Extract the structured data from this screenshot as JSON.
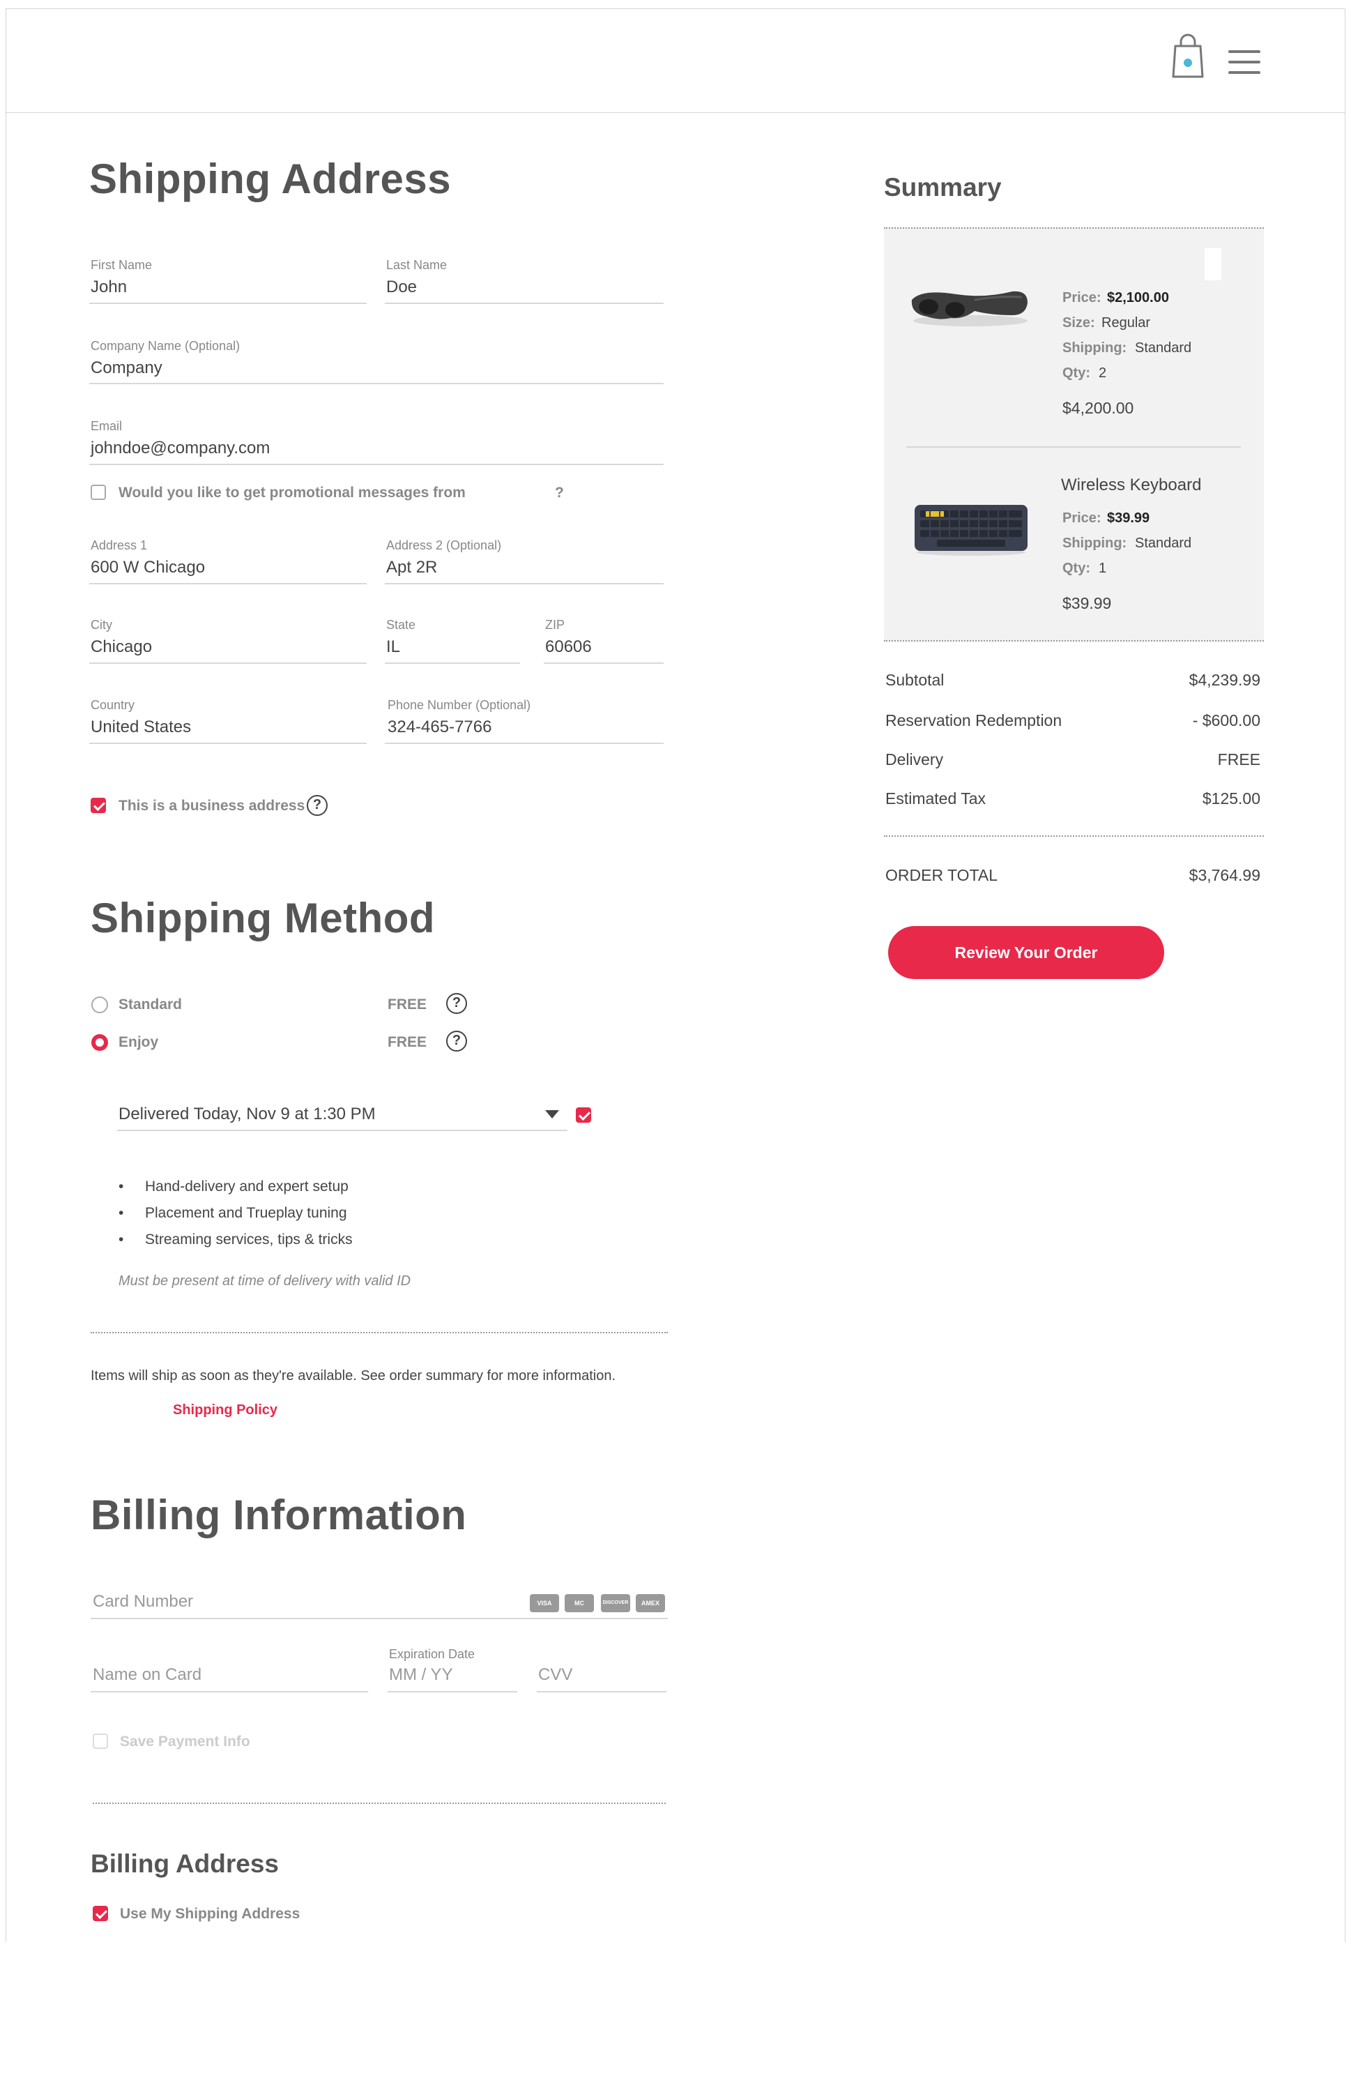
{
  "header": {
    "bag_icon": "shopping-bag-icon",
    "menu_icon": "hamburger-menu-icon"
  },
  "shipping_address": {
    "title": "Shipping Address",
    "first_name": {
      "label": "First Name",
      "value": "John"
    },
    "last_name": {
      "label": "Last Name",
      "value": "Doe"
    },
    "company": {
      "label": "Company Name (Optional)",
      "value": "Company"
    },
    "email": {
      "label": "Email",
      "value": "johndoe@company.com"
    },
    "promo_label": "Would you like to get promotional messages from",
    "promo_suffix": "?",
    "address1": {
      "label": "Address 1",
      "value": "600 W Chicago"
    },
    "address2": {
      "label": "Address 2 (Optional)",
      "value": "Apt 2R"
    },
    "city": {
      "label": "City",
      "value": "Chicago"
    },
    "state": {
      "label": "State",
      "value": "IL"
    },
    "zip": {
      "label": "ZIP",
      "value": "60606"
    },
    "country": {
      "label": "Country",
      "value": "United States"
    },
    "phone": {
      "label": "Phone Number (Optional)",
      "value": "324-465-7766"
    },
    "business_label": "This is a business address"
  },
  "shipping_method": {
    "title": "Shipping Method",
    "options": [
      {
        "label": "Standard",
        "price": "FREE",
        "selected": false
      },
      {
        "label": "Enjoy",
        "price": "FREE",
        "selected": true
      }
    ],
    "delivery_time": "Delivered Today, Nov 9 at 1:30 PM",
    "bullets": [
      "Hand-delivery and expert setup",
      "Placement and Trueplay tuning",
      "Streaming services, tips & tricks"
    ],
    "note": "Must be present at time of delivery with valid ID",
    "ship_info": "Items will ship as soon as they're available. See order summary for more information.",
    "policy_link": "Shipping Policy"
  },
  "billing": {
    "title": "Billing Information",
    "card_number_placeholder": "Card Number",
    "card_logos": [
      "VISA",
      "MC",
      "DISCOVER",
      "AMEX"
    ],
    "name_placeholder": "Name on Card",
    "expiration_label": "Expiration Date",
    "expiration_placeholder": "MM / YY",
    "cvv_placeholder": "CVV",
    "save_label": "Save Payment Info",
    "address_title": "Billing Address",
    "use_shipping_label": "Use My Shipping Address"
  },
  "summary": {
    "title": "Summary",
    "items": [
      {
        "name": "",
        "price_label": "Price:",
        "price": "$2,100.00",
        "size_label": "Size:",
        "size": "Regular",
        "shipping_label": "Shipping:",
        "shipping": "Standard",
        "qty_label": "Qty:",
        "qty": "2",
        "total": "$4,200.00"
      },
      {
        "name": "Wireless Keyboard",
        "price_label": "Price:",
        "price": "$39.99",
        "shipping_label": "Shipping:",
        "shipping": "Standard",
        "qty_label": "Qty:",
        "qty": "1",
        "total": "$39.99"
      }
    ],
    "subtotal_label": "Subtotal",
    "subtotal": "$4,239.99",
    "redemption_label": "Reservation Redemption",
    "redemption": "- $600.00",
    "delivery_label": "Delivery",
    "delivery": "FREE",
    "tax_label": "Estimated Tax",
    "tax": "$125.00",
    "total_label": "ORDER TOTAL",
    "total": "$3,764.99",
    "review_button": "Review Your Order"
  },
  "colors": {
    "accent": "#e8294a",
    "text": "#444444",
    "muted": "#888888"
  }
}
